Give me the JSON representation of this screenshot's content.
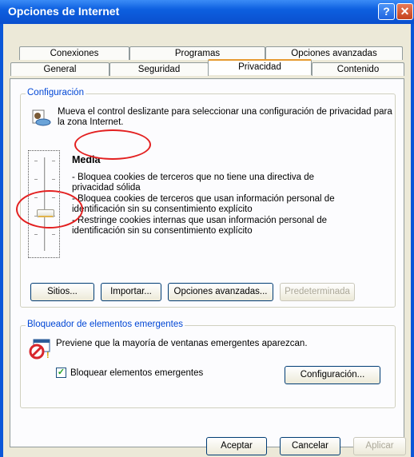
{
  "window": {
    "title": "Opciones de Internet",
    "help_glyph": "?",
    "close_glyph": "✕"
  },
  "tabs_row1": [
    "Conexiones",
    "Programas",
    "Opciones avanzadas"
  ],
  "tabs_row2": [
    "General",
    "Seguridad",
    "Privacidad",
    "Contenido"
  ],
  "active_tab": "Privacidad",
  "settings": {
    "group_label": "Configuración",
    "description": "Mueva el control deslizante para seleccionar una configuración de privacidad para la zona Internet.",
    "level_name": "Media",
    "level_details": [
      "- Bloquea cookies de terceros que no tiene una directiva de privacidad sólida",
      "- Bloquea cookies de terceros que usan información personal de identificación sin su consentimiento explícito",
      "- Restringe cookies internas que usan información personal de identificación sin su consentimiento explícito"
    ],
    "buttons": {
      "sites": "Sitios...",
      "import": "Importar...",
      "advanced": "Opciones avanzadas...",
      "default": "Predeterminada"
    }
  },
  "popup_blocker": {
    "group_label": "Bloqueador de elementos emergentes",
    "description": "Previene que la mayoría de ventanas emergentes aparezcan.",
    "checkbox_label": "Bloquear elementos emergentes",
    "checkbox_checked": true,
    "settings_button": "Configuración..."
  },
  "footer": {
    "ok": "Aceptar",
    "cancel": "Cancelar",
    "apply": "Aplicar"
  }
}
